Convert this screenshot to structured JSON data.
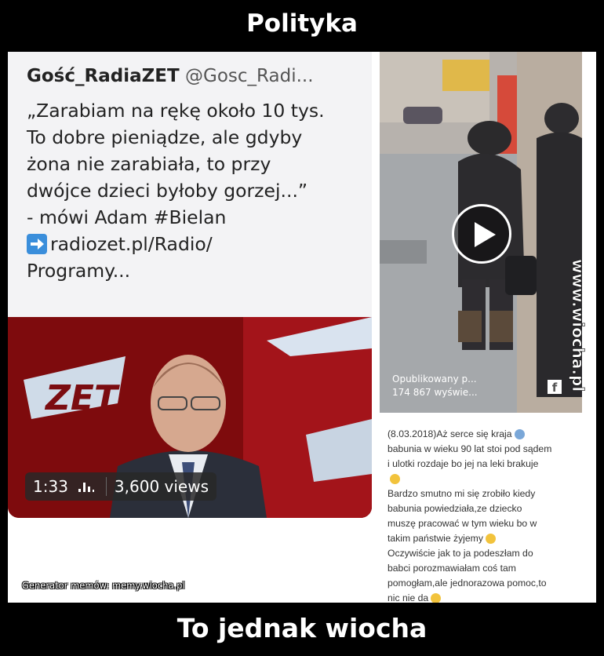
{
  "meme": {
    "title": "Polityka",
    "caption": "To jednak wiocha",
    "watermark": "www.wiocha.pl",
    "generator": "Generator memów:  memy.wiocha.pl"
  },
  "tweet": {
    "author_name": "Gość_RadiaZET",
    "author_handle": "@Gosc_Radi...",
    "lines": [
      "„Zarabiam na rękę około 10 tys.",
      "To dobre pieniądze, ale gdyby",
      "żona nie zarabiała, to przy",
      "dwójce dzieci byłoby gorzej...”",
      "- mówi Adam #Bielan"
    ],
    "link_line1": "radiozet.pl/Radio/",
    "link_line2": "Programy...",
    "link_icon": "arrow-right-icon",
    "video": {
      "logo": "ZET",
      "duration": "1:33",
      "views": "3,600 views"
    }
  },
  "post": {
    "published_line1": "Opublikowany p...",
    "published_line2": "174 867 wyświe...",
    "fb_icon": "f",
    "lines": [
      "(8.03.2018)Aż serce się kraja",
      "babunia w wieku 90 lat stoi pod sądem",
      "i ulotki rozdaje bo jej na leki brakuje",
      "",
      "Bardzo smutno mi się zrobiło kiedy",
      "babunia powiedziała,ze dziecko",
      "muszę pracować w tym wieku bo w",
      "takim państwie żyjemy",
      "Oczywiście jak to ja podeszłam do",
      "babci porozmawiałam coś tam",
      "pomogłam,ale jednorazowa pomoc,to",
      "nic nie da"
    ]
  },
  "colors": {
    "background": "#000000",
    "tweet_bg": "#f3f3f5",
    "link_icon": "#3a8edb",
    "video_bg": "#8a0d10"
  }
}
